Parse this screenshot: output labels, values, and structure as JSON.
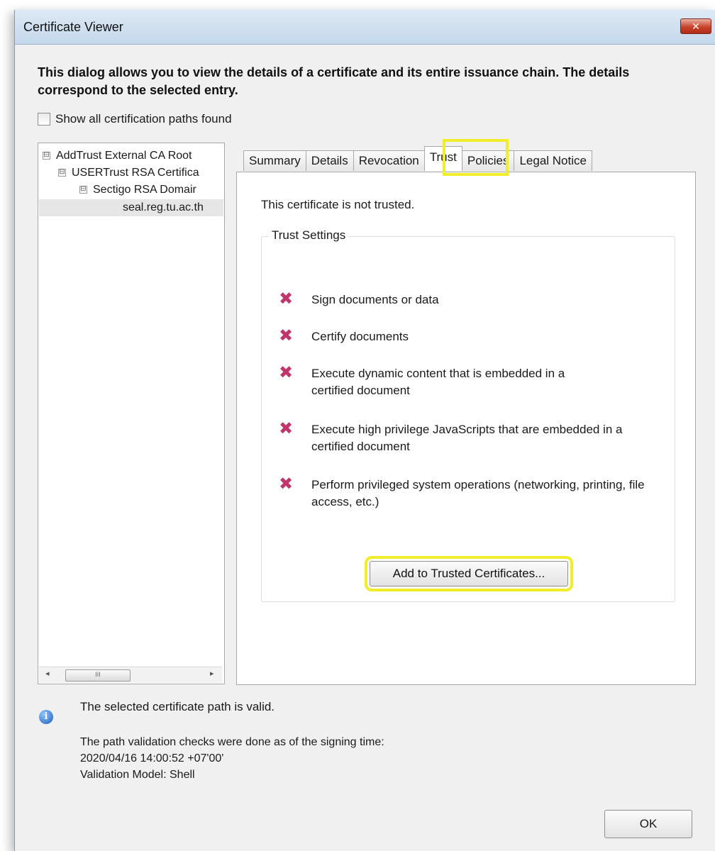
{
  "window": {
    "title": "Certificate Viewer",
    "close_label": "✕"
  },
  "intro_text": "This dialog allows you to view the details of a certificate and its entire issuance chain. The details correspond to the selected entry.",
  "show_all_label": "Show all certification paths found",
  "tree": {
    "items": [
      {
        "label": "AddTrust External CA Root",
        "expander": "⊟"
      },
      {
        "label": "USERTrust RSA Certifica",
        "expander": "⊟"
      },
      {
        "label": "Sectigo RSA Domair",
        "expander": "⊟"
      },
      {
        "label": "seal.reg.tu.ac.th",
        "expander": ""
      }
    ],
    "scroll_thumb": "III"
  },
  "tabs": [
    "Summary",
    "Details",
    "Revocation",
    "Trust",
    "Policies",
    "Legal Notice"
  ],
  "active_tab": "Trust",
  "trust": {
    "status": "This certificate is not trusted.",
    "group_label": "Trust Settings",
    "items": [
      "Sign documents or data",
      "Certify documents",
      "Execute dynamic content that is embedded in a certified document",
      "Execute high privilege JavaScripts that are embedded in a certified document",
      "Perform privileged system operations (networking, printing, file access, etc.)"
    ],
    "add_button": "Add to Trusted Certificates..."
  },
  "footer": {
    "valid_text": "The selected certificate path is valid.",
    "check_line": "The path validation checks were done as of the signing time:",
    "timestamp": "2020/04/16 14:00:52 +07'00'",
    "model": "Validation Model: Shell",
    "ok_label": "OK"
  },
  "colors": {
    "highlight": "#f0ee2a",
    "denied_icon": "#c0356a"
  }
}
